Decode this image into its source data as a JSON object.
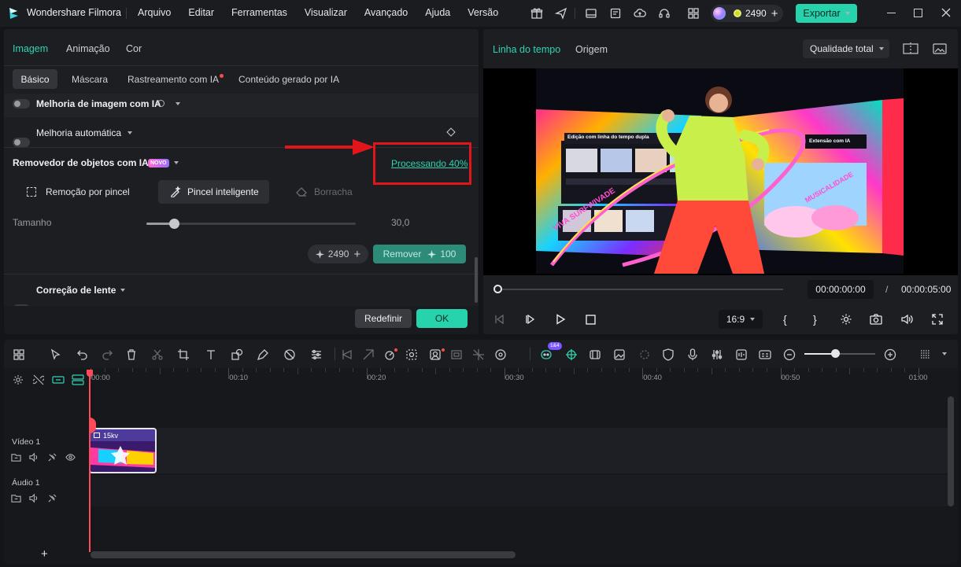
{
  "titlebar": {
    "app_title": "Wondershare Filmora",
    "menu": [
      "Arquivo",
      "Editar",
      "Ferramentas",
      "Visualizar",
      "Avançado",
      "Ajuda",
      "Versão"
    ],
    "credits": "2490",
    "export_label": "Exportar"
  },
  "panel": {
    "tabs": [
      "Imagem",
      "Animação",
      "Cor"
    ],
    "subtabs": [
      "Básico",
      "Máscara",
      "Rastreamento com IA",
      "Conteúdo gerado por IA"
    ],
    "ai_image_enhance": "Melhoria de imagem com IA",
    "auto_enhance": "Melhoria automática",
    "object_remover": "Removedor de objetos com IA",
    "new_badge": "NOVO",
    "processing": "Processando 40%",
    "tools": [
      "Remoção por pincel",
      "Pincel inteligente",
      "Borracha"
    ],
    "size_label": "Tamanho",
    "size_value": "30,0",
    "size_fraction": 0.13,
    "cost_credits": "2490",
    "remove_label": "Remover",
    "remove_cost": "100",
    "lens_correction": "Correção de lente",
    "reset_label": "Redefinir",
    "ok_label": "OK"
  },
  "preview": {
    "tabs": [
      "Linha do tempo",
      "Origem"
    ],
    "quality": "Qualidade total",
    "current_time": "00:00:00:00",
    "separator": "/",
    "total_time": "00:00:05:00",
    "aspect": "16:9",
    "bracket_in": "{",
    "bracket_out": "}",
    "video_texts": {
      "edit_text": "Edição com linha do tempo dupla",
      "ext_text": "Extensão com IA",
      "viva_text": "VIVA SURFWIVADE",
      "right_text": "MUSICALIDADE"
    }
  },
  "timeline": {
    "ruler": [
      "00:00",
      "00:10",
      "00:20",
      "00:30",
      "00:40",
      "00:50",
      "01:00"
    ],
    "ai_badge": "1&4",
    "tracks": [
      {
        "name": "Vídeo 1"
      },
      {
        "name": "Áudio 1"
      }
    ],
    "clip_label": "15kv",
    "add_track": "+"
  },
  "colors": {
    "accent": "#19c3a0",
    "highlight_red": "#e0161b",
    "bg": "#141519",
    "panel": "#1d1e22"
  }
}
